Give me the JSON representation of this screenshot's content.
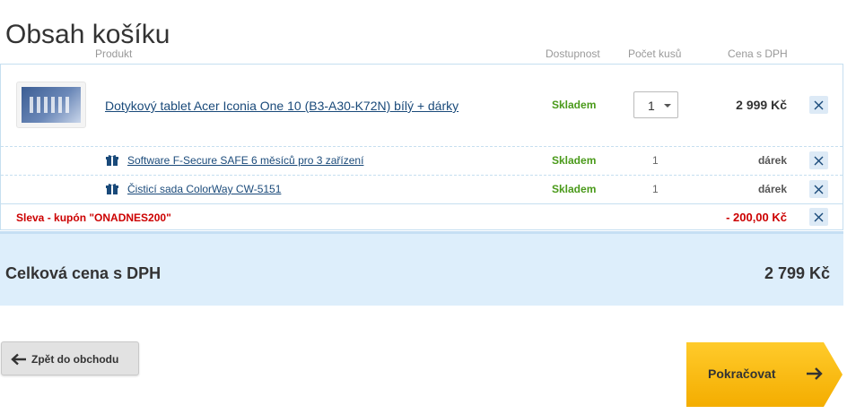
{
  "page": {
    "title": "Obsah košíku"
  },
  "columns": {
    "product": "Produkt",
    "availability": "Dostupnost",
    "quantity": "Počet kusů",
    "price": "Cena s DPH"
  },
  "items": [
    {
      "name": "Dotykový tablet Acer Iconia One 10 (B3-A30-K72N) bílý + dárky",
      "availability": "Skladem",
      "quantity": "1",
      "price": "2 999 Kč"
    }
  ],
  "gifts": [
    {
      "name": "Software F-Secure SAFE 6 měsíců pro 3 zařízení",
      "availability": "Skladem",
      "quantity": "1",
      "price": "dárek"
    },
    {
      "name": "Čisticí sada ColorWay CW-5151",
      "availability": "Skladem",
      "quantity": "1",
      "price": "dárek"
    }
  ],
  "coupon": {
    "label": "Sleva - kupón \"ONADNES200\"",
    "value": "- 200,00 Kč"
  },
  "total": {
    "label": "Celková cena s DPH",
    "value": "2 799 Kč"
  },
  "buttons": {
    "back": "Zpět do obchodu",
    "continue": "Pokračovat"
  },
  "icons": {
    "remove": "close-icon",
    "gift": "gift-icon",
    "back": "arrow-left-icon",
    "continue": "arrow-right-icon",
    "dropdown": "chevron-down-icon"
  },
  "colors": {
    "link": "#1a4a7a",
    "in_stock": "#4a9a1a",
    "discount": "#cc0000",
    "total_bg": "#ddeefb",
    "continue_bg": "#f7b500"
  }
}
